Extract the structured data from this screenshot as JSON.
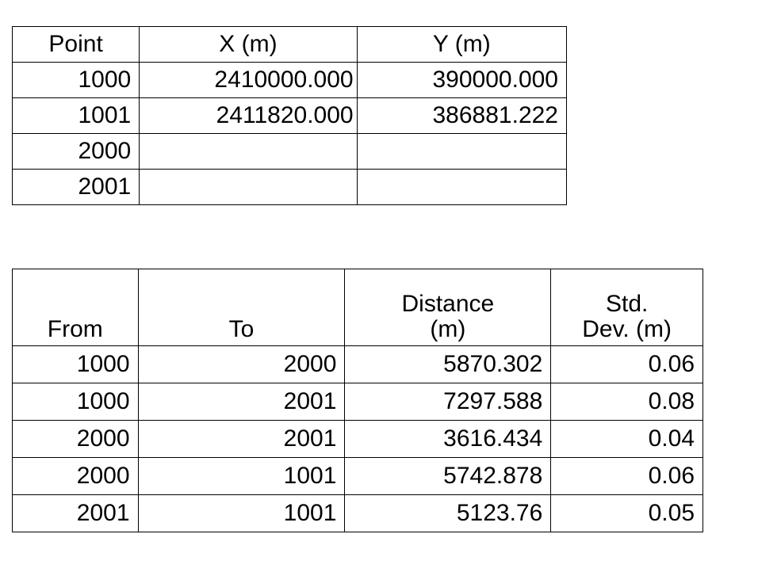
{
  "coordinate_table": {
    "name": "point-coordinates-table",
    "columns": [
      "Point",
      "X (m)",
      "Y (m)"
    ],
    "rows": [
      {
        "point": "1000",
        "x": "2410000.000",
        "y": "390000.000"
      },
      {
        "point": "1001",
        "x": "2411820.000",
        "y": "386881.222"
      },
      {
        "point": "2000",
        "x": "",
        "y": ""
      },
      {
        "point": "2001",
        "x": "",
        "y": ""
      }
    ]
  },
  "distance_table": {
    "name": "observed-distances-table",
    "columns": [
      {
        "line1": "",
        "line2": "From"
      },
      {
        "line1": "",
        "line2": "To"
      },
      {
        "line1": "Distance",
        "line2": "(m)"
      },
      {
        "line1": "Std.",
        "line2": "Dev. (m)"
      }
    ],
    "rows": [
      {
        "from": "1000",
        "to": "2000",
        "distance": "5870.302",
        "std_dev": "0.06"
      },
      {
        "from": "1000",
        "to": "2001",
        "distance": "7297.588",
        "std_dev": "0.08"
      },
      {
        "from": "2000",
        "to": "2001",
        "distance": "3616.434",
        "std_dev": "0.04"
      },
      {
        "from": "2000",
        "to": "1001",
        "distance": "5742.878",
        "std_dev": "0.06"
      },
      {
        "from": "2001",
        "to": "1001",
        "distance": "5123.76",
        "std_dev": "0.05"
      }
    ]
  },
  "colors": {
    "background": "#ffffff",
    "text": "#000000",
    "border": "#000000"
  }
}
